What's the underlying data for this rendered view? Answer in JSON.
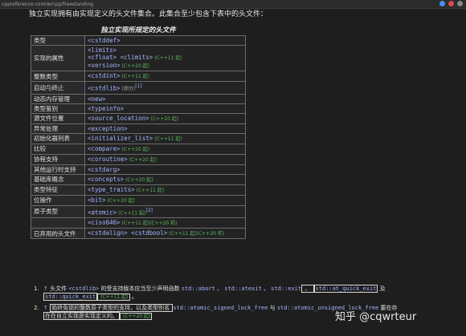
{
  "browser": {
    "url": "cppreference.com/w/cpp/freestanding"
  },
  "intro_text": "独立实现拥有由实现定义的头文件集合。此集合至少包含下表中的头文件：",
  "caption": "独立实现所规定的头文件",
  "rows": [
    {
      "category": "类型",
      "headers": [
        {
          "name": "<cstddef>",
          "ver": ""
        }
      ],
      "note": ""
    },
    {
      "category": "实现的属性",
      "headers": [
        {
          "name": "<limits>",
          "ver": ""
        },
        {
          "name": "<cfloat> <climits>",
          "ver": "(C++11 起)"
        },
        {
          "name": "<version>",
          "ver": "(C++20 起)"
        }
      ],
      "note": ""
    },
    {
      "category": "整数类型",
      "headers": [
        {
          "name": "<cstdint>",
          "ver": "(C++11 起)"
        }
      ],
      "note": ""
    },
    {
      "category": "启动与终止",
      "headers": [
        {
          "name": "<cstdlib>",
          "ver": ""
        }
      ],
      "note": "(部分)",
      "sup": "[1]"
    },
    {
      "category": "动态内存管理",
      "headers": [
        {
          "name": "<new>",
          "ver": ""
        }
      ],
      "note": ""
    },
    {
      "category": "类型鉴别",
      "headers": [
        {
          "name": "<typeinfo>",
          "ver": ""
        }
      ],
      "note": ""
    },
    {
      "category": "源文件位置",
      "headers": [
        {
          "name": "<source_location>",
          "ver": "(C++20 起)"
        }
      ],
      "note": ""
    },
    {
      "category": "异常处理",
      "headers": [
        {
          "name": "<exception>",
          "ver": ""
        }
      ],
      "note": ""
    },
    {
      "category": "初始化器列表",
      "headers": [
        {
          "name": "<initializer_list>",
          "ver": "(C++11 起)"
        }
      ],
      "note": ""
    },
    {
      "category": "比较",
      "headers": [
        {
          "name": "<compare>",
          "ver": "(C++20 起)"
        }
      ],
      "note": ""
    },
    {
      "category": "协程支持",
      "headers": [
        {
          "name": "<coroutine>",
          "ver": "(C++20 起)"
        }
      ],
      "note": ""
    },
    {
      "category": "其他运行时支持",
      "headers": [
        {
          "name": "<cstdarg>",
          "ver": ""
        }
      ],
      "note": ""
    },
    {
      "category": "基础库概念",
      "headers": [
        {
          "name": "<concepts>",
          "ver": "(C++20 起)"
        }
      ],
      "note": ""
    },
    {
      "category": "类型特征",
      "headers": [
        {
          "name": "<type_traits>",
          "ver": "(C++11 起)"
        }
      ],
      "note": ""
    },
    {
      "category": "位操作",
      "headers": [
        {
          "name": "<bit>",
          "ver": "(C++20 起)"
        }
      ],
      "note": ""
    },
    {
      "category": "原子类型",
      "headers": [
        {
          "name": "<atomic>",
          "ver": "(C++11 起)"
        }
      ],
      "note": "",
      "sup": "[2]"
    },
    {
      "category": "",
      "headers": [
        {
          "name": "<ciso646>",
          "ver": "(C++11 起)(C++20 前)"
        }
      ],
      "note": ""
    },
    {
      "category": "已弃用的头文件",
      "headers": [
        {
          "name": "<cstdalign> <cstdbool>",
          "ver": "(C++11 起)(C++20 前)"
        }
      ],
      "note": ""
    }
  ],
  "footnotes": [
    {
      "num": "1.",
      "arrow": "↑",
      "parts": [
        {
          "t": "头文件 ",
          "c": ""
        },
        {
          "t": "<cstdlib>",
          "c": "code"
        },
        {
          "t": " 的受支持版本应当至少声明函数 ",
          "c": ""
        },
        {
          "t": "std::abort",
          "c": "code"
        },
        {
          "t": " 、 ",
          "c": ""
        },
        {
          "t": "std::atexit",
          "c": "code"
        },
        {
          "t": " 、 ",
          "c": ""
        },
        {
          "t": "std::exit",
          "c": "code"
        },
        {
          "t": " 、 ",
          "c": "box"
        },
        {
          "t": "std::at_quick_exit",
          "c": "code box"
        },
        {
          "t": " 及",
          "c": ""
        }
      ],
      "parts2": [
        {
          "t": "std::quick_exit",
          "c": "code box"
        },
        {
          "t": " (C++11 起)",
          "c": "ver box"
        },
        {
          "t": " 。",
          "c": ""
        }
      ]
    },
    {
      "num": "2.",
      "arrow": "↑",
      "parts": [
        {
          "t": "始终免锁的整数原子类型的支持，以及类型别名 ",
          "c": "box"
        },
        {
          "t": "std::atomic_signed_lock_free",
          "c": "code"
        },
        {
          "t": " 与 ",
          "c": ""
        },
        {
          "t": "std::atomic_unsigned_lock_free",
          "c": "code"
        },
        {
          "t": " 要在存",
          "c": ""
        }
      ],
      "parts2": [
        {
          "t": "在在自立实现是实现定义的。",
          "c": "box"
        },
        {
          "t": " (C++20 起)",
          "c": "ver box"
        }
      ]
    }
  ],
  "watermark": "知乎 @cqwrteur"
}
